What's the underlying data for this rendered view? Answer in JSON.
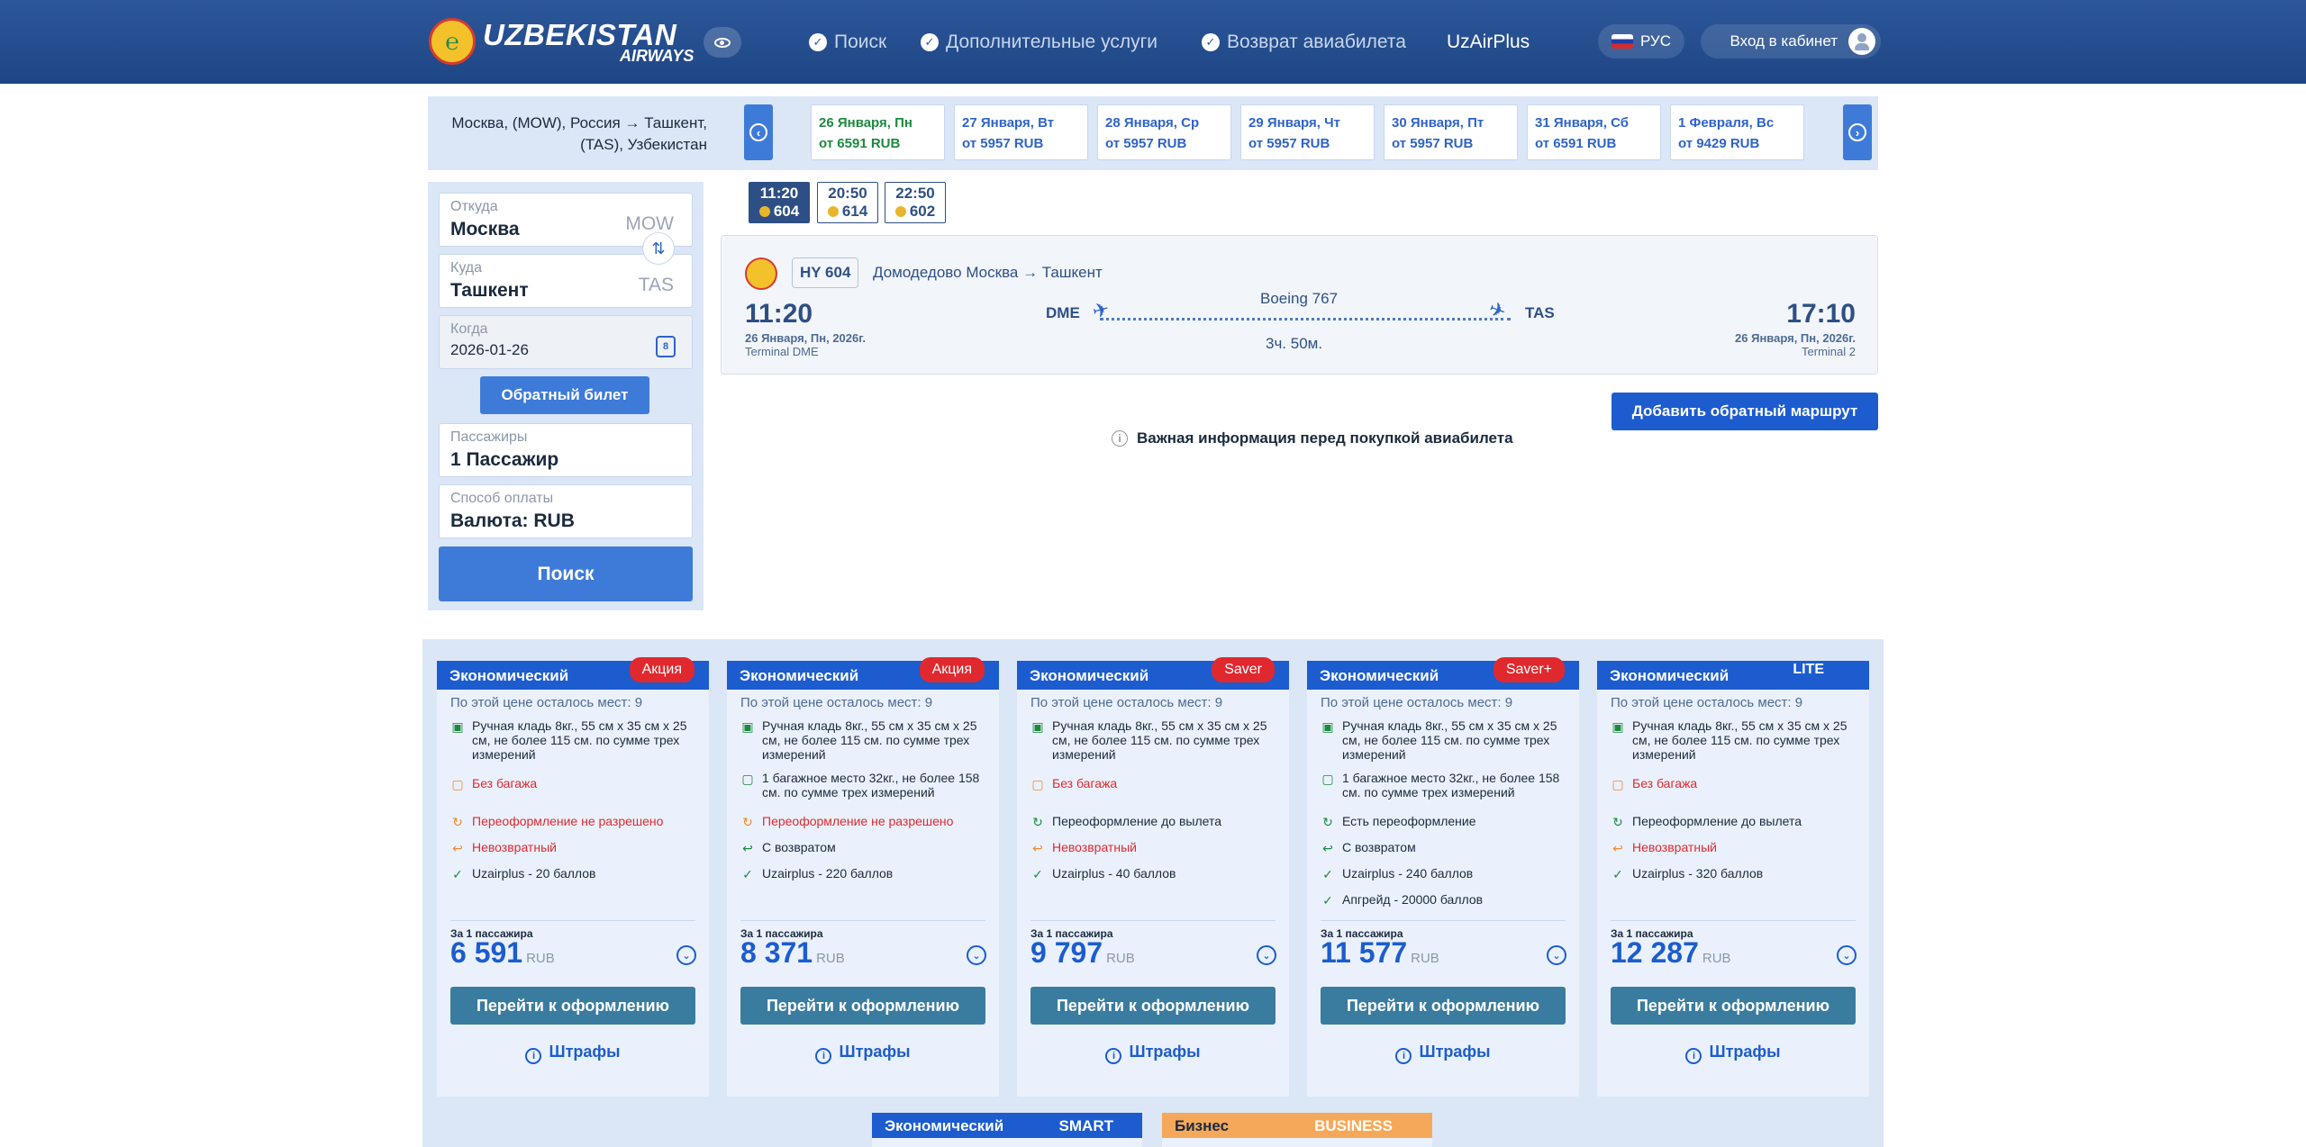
{
  "header": {
    "logo_main": "UZBEKISTAN",
    "logo_sub": "AIRWAYS",
    "nav": [
      "Поиск",
      "Дополнительные услуги",
      "Возврат авиабилета"
    ],
    "nav_plus": "UzAirPlus",
    "lang": "РУС",
    "login": "Вход в кабинет"
  },
  "datebar": {
    "route_line1": "Москва, (MOW), Россия → Ташкент,",
    "route_line2": "(TAS), Узбекистан",
    "dates": [
      {
        "date": "26 Января, Пн",
        "price": "от 6591 RUB",
        "active": true
      },
      {
        "date": "27 Января, Вт",
        "price": "от 5957 RUB"
      },
      {
        "date": "28 Января, Ср",
        "price": "от 5957 RUB"
      },
      {
        "date": "29 Января, Чт",
        "price": "от 5957 RUB"
      },
      {
        "date": "30 Января, Пт",
        "price": "от 5957 RUB"
      },
      {
        "date": "31 Января, Сб",
        "price": "от 6591 RUB"
      },
      {
        "date": "1 Февраля, Вс",
        "price": "от 9429 RUB"
      }
    ]
  },
  "search": {
    "from_label": "Откуда",
    "from_value": "Москва",
    "from_code": "MOW",
    "to_label": "Куда",
    "to_value": "Ташкент",
    "to_code": "TAS",
    "when_label": "Когда",
    "when_value": "2026-01-26",
    "cal_day": "8",
    "return_btn": "Обратный билет",
    "pax_label": "Пассажиры",
    "pax_value": "1 Пассажир",
    "pay_label": "Способ оплаты",
    "pay_value": "Валюта: RUB",
    "search_btn": "Поиск"
  },
  "time_tabs": [
    {
      "time": "11:20",
      "num": "604",
      "selected": true
    },
    {
      "time": "20:50",
      "num": "614"
    },
    {
      "time": "22:50",
      "num": "602"
    }
  ],
  "flight": {
    "code": "HY 604",
    "route": "Домодедово Москва → Ташкент",
    "dep_time": "11:20",
    "dep_date": "26 Января, Пн, 2026г.",
    "dep_term": "Terminal DME",
    "dep_apt": "DME",
    "aircraft": "Boeing 767",
    "duration": "3ч. 50м.",
    "arr_apt": "TAS",
    "arr_time": "17:10",
    "arr_date": "26 Января, Пн, 2026г.",
    "arr_term": "Terminal 2"
  },
  "add_return": "Добавить обратный маршрут",
  "important": "Важная информация перед покупкой авиабилета",
  "fares": [
    {
      "title": "Экономический",
      "badge": "Акция",
      "seats": "По этой цене осталось мест: 9",
      "features": [
        {
          "text": "Ручная кладь 8кг., 55 см х 35 см х 25 см, не более 115 см. по сумме трех измерений",
          "type": "grn",
          "icon": "▣"
        },
        {
          "text": "Без багажа",
          "type": "orn",
          "icon": "▢"
        },
        {
          "text": "Переоформление не разрешено",
          "type": "orn",
          "icon": "↻"
        },
        {
          "text": "Невозвратный",
          "type": "orn",
          "icon": "↩"
        },
        {
          "text": "Uzairplus - 20 баллов",
          "type": "grn",
          "icon": "✓"
        }
      ],
      "per_pax": "За 1 пассажира",
      "price": "6 591",
      "currency": "RUB",
      "go": "Перейти к оформлению",
      "fines": "Штрафы"
    },
    {
      "title": "Экономический",
      "badge": "Акция",
      "seats": "По этой цене осталось мест: 9",
      "features": [
        {
          "text": "Ручная кладь 8кг., 55 см х 35 см х 25 см, не более 115 см. по сумме трех измерений",
          "type": "grn",
          "icon": "▣"
        },
        {
          "text": "1 багажное место 32кг., не более 158 см. по сумме трех измерений",
          "type": "grn",
          "icon": "▢"
        },
        {
          "text": "Переоформление не разрешено",
          "type": "orn",
          "icon": "↻"
        },
        {
          "text": "С возвратом",
          "type": "grn",
          "icon": "↩"
        },
        {
          "text": "Uzairplus - 220 баллов",
          "type": "grn",
          "icon": "✓"
        }
      ],
      "per_pax": "За 1 пассажира",
      "price": "8 371",
      "currency": "RUB",
      "go": "Перейти к оформлению",
      "fines": "Штрафы"
    },
    {
      "title": "Экономический",
      "badge": "Saver",
      "seats": "По этой цене осталось мест: 9",
      "features": [
        {
          "text": "Ручная кладь 8кг., 55 см х 35 см х 25 см, не более 115 см. по сумме трех измерений",
          "type": "grn",
          "icon": "▣"
        },
        {
          "text": "Без багажа",
          "type": "orn",
          "icon": "▢"
        },
        {
          "text": "Переоформление до вылета",
          "type": "grn",
          "icon": "↻"
        },
        {
          "text": "Невозвратный",
          "type": "orn",
          "icon": "↩"
        },
        {
          "text": "Uzairplus - 40 баллов",
          "type": "grn",
          "icon": "✓"
        }
      ],
      "per_pax": "За 1 пассажира",
      "price": "9 797",
      "currency": "RUB",
      "go": "Перейти к оформлению",
      "fines": "Штрафы"
    },
    {
      "title": "Экономический",
      "badge": "Saver+",
      "seats": "По этой цене осталось мест: 9",
      "features": [
        {
          "text": "Ручная кладь 8кг., 55 см х 35 см х 25 см, не более 115 см. по сумме трех измерений",
          "type": "grn",
          "icon": "▣"
        },
        {
          "text": "1 багажное место 32кг., не более 158 см. по сумме трех измерений",
          "type": "grn",
          "icon": "▢"
        },
        {
          "text": "Есть переоформление",
          "type": "grn",
          "icon": "↻"
        },
        {
          "text": "С возвратом",
          "type": "grn",
          "icon": "↩"
        },
        {
          "text": "Uzairplus - 240 баллов",
          "type": "grn",
          "icon": "✓"
        },
        {
          "text": "Апгрейд - 20000 баллов",
          "type": "grn",
          "icon": "✓"
        }
      ],
      "per_pax": "За 1 пассажира",
      "price": "11 577",
      "currency": "RUB",
      "go": "Перейти к оформлению",
      "fines": "Штрафы"
    },
    {
      "title": "Экономический",
      "badge": "LITE",
      "seats": "По этой цене осталось мест: 9",
      "features": [
        {
          "text": "Ручная кладь 8кг., 55 см х 35 см х 25 см, не более 115 см. по сумме трех измерений",
          "type": "grn",
          "icon": "▣"
        },
        {
          "text": "Без багажа",
          "type": "orn",
          "icon": "▢"
        },
        {
          "text": "Переоформление до вылета",
          "type": "grn",
          "icon": "↻"
        },
        {
          "text": "Невозвратный",
          "type": "orn",
          "icon": "↩"
        },
        {
          "text": "Uzairplus - 320 баллов",
          "type": "grn",
          "icon": "✓"
        }
      ],
      "per_pax": "За 1 пассажира",
      "price": "12 287",
      "currency": "RUB",
      "go": "Перейти к оформлению",
      "fines": "Штрафы"
    }
  ],
  "more_fares": [
    {
      "title": "Экономический",
      "tag": "SMART",
      "color": "#1c5ccf"
    },
    {
      "title": "Бизнес",
      "tag": "BUSINESS",
      "color": "#f6a85a"
    }
  ],
  "colors": {
    "primary": "#1c5ccf",
    "header": "#2c5799",
    "promo": "#e0292f"
  }
}
